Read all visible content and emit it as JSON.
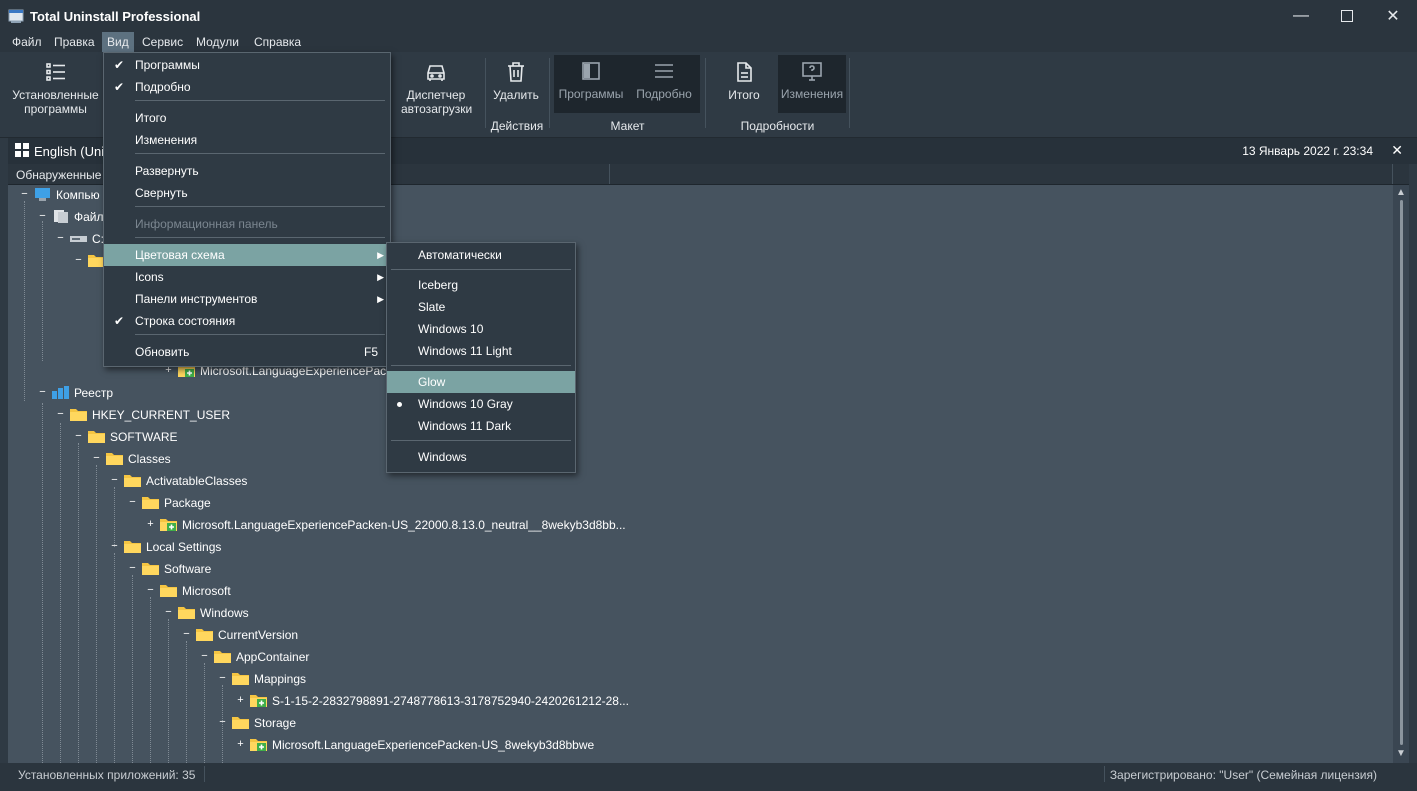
{
  "window": {
    "title": "Total Uninstall Professional"
  },
  "menubar": [
    "Файл",
    "Правка",
    "Вид",
    "Сервис",
    "Модули",
    "Справка"
  ],
  "ribbon": {
    "installed": "Установленные программы",
    "startup": "Диспетчер автозагрузки",
    "delete": "Удалить",
    "layout_programs": "Программы",
    "layout_detailed": "Подробно",
    "summary": "Итого",
    "changes": "Изменения",
    "group_actions": "Действия",
    "group_layout": "Макет",
    "group_details": "Подробности"
  },
  "tab": {
    "label": "English (Uni",
    "date": "13 Январь 2022 г. 23:34"
  },
  "column_header": "Обнаруженные",
  "view_menu": {
    "items": [
      {
        "label": "Программы",
        "checked": true
      },
      {
        "label": "Подробно",
        "checked": true
      },
      {
        "label": "Итого"
      },
      {
        "label": "Изменения"
      },
      {
        "label": "Развернуть"
      },
      {
        "label": "Свернуть"
      },
      {
        "label": "Информационная панель",
        "disabled": true
      },
      {
        "label": "Цветовая схема",
        "submenu": true,
        "highlighted": true
      },
      {
        "label": "Icons",
        "submenu": true
      },
      {
        "label": "Панели инструментов",
        "submenu": true
      },
      {
        "label": "Строка состояния",
        "checked": true
      },
      {
        "label": "Обновить",
        "shortcut": "F5"
      }
    ]
  },
  "color_scheme_menu": {
    "items": [
      {
        "label": "Автоматически"
      },
      {
        "label": "Iceberg"
      },
      {
        "label": "Slate"
      },
      {
        "label": "Windows 10"
      },
      {
        "label": "Windows 11 Light"
      },
      {
        "label": "Glow",
        "highlighted": true
      },
      {
        "label": "Windows 10 Gray",
        "selected": true
      },
      {
        "label": "Windows 11 Dark"
      },
      {
        "label": "Windows"
      }
    ]
  },
  "tree": [
    {
      "label": "Компью",
      "icon": "computer-icon"
    },
    {
      "label": "Файл",
      "icon": "files-icon"
    },
    {
      "label": "C:",
      "icon": "drive-icon"
    },
    {
      "label": "",
      "icon": "folder-icon"
    },
    {
      "label": "Microsoft.LanguageExperiencePack",
      "icon": "package-icon"
    },
    {
      "label": "Реестр",
      "icon": "registry-icon"
    },
    {
      "label": "HKEY_CURRENT_USER",
      "icon": "folder-icon"
    },
    {
      "label": "SOFTWARE",
      "icon": "folder-icon"
    },
    {
      "label": "Classes",
      "icon": "folder-icon"
    },
    {
      "label": "ActivatableClasses",
      "icon": "folder-icon"
    },
    {
      "label": "Package",
      "icon": "folder-icon"
    },
    {
      "label": "Microsoft.LanguageExperiencePacken-US_22000.8.13.0_neutral__8wekyb3d8bb...",
      "icon": "package-icon"
    },
    {
      "label": "Local Settings",
      "icon": "folder-icon"
    },
    {
      "label": "Software",
      "icon": "folder-icon"
    },
    {
      "label": "Microsoft",
      "icon": "folder-icon"
    },
    {
      "label": "Windows",
      "icon": "folder-icon"
    },
    {
      "label": "CurrentVersion",
      "icon": "folder-icon"
    },
    {
      "label": "AppContainer",
      "icon": "folder-icon"
    },
    {
      "label": "Mappings",
      "icon": "folder-icon"
    },
    {
      "label": "S-1-15-2-2832798891-2748778613-3178752940-2420261212-28...",
      "icon": "package-icon"
    },
    {
      "label": "Storage",
      "icon": "folder-icon"
    },
    {
      "label": "Microsoft.LanguageExperiencePacken-US_8wekyb3d8bbwe",
      "icon": "package-icon"
    }
  ],
  "status": {
    "left": "Установленных приложений: 35",
    "right": "Зарегистрировано: \"User\" (Семейная лицензия)"
  }
}
